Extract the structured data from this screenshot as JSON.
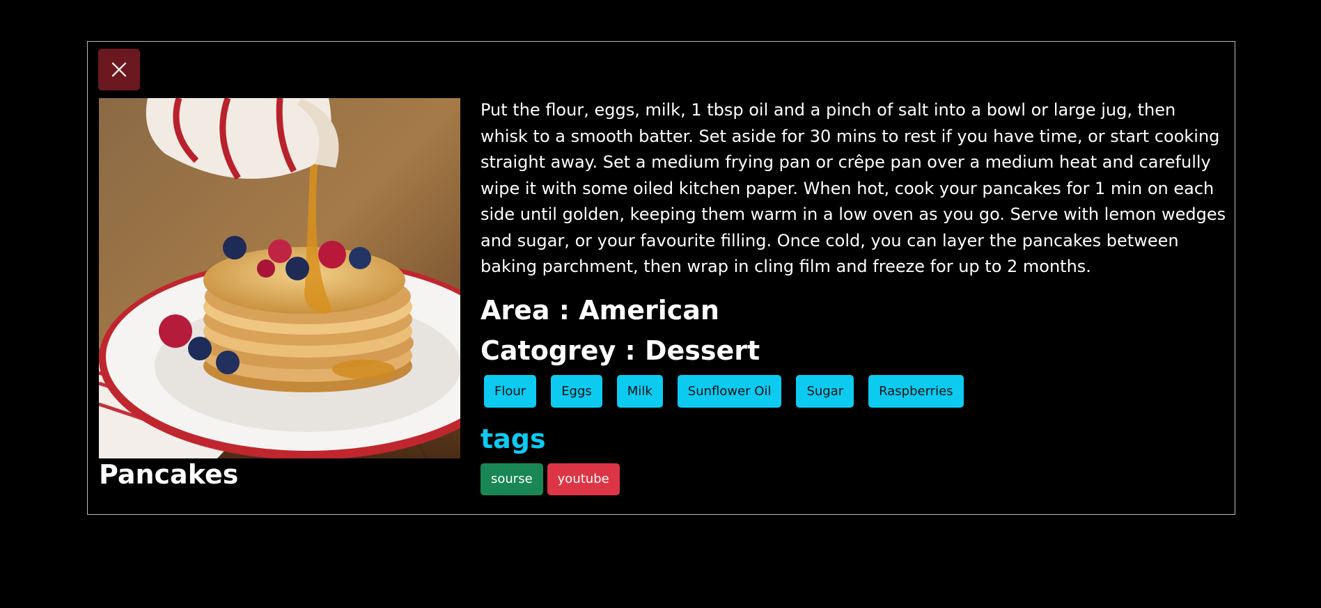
{
  "meal": {
    "name": "Pancakes",
    "image_alt": "Stack of pancakes with berries and syrup",
    "instructions": "Put the flour, eggs, milk, 1 tbsp oil and a pinch of salt into a bowl or large jug, then whisk to a smooth batter. Set aside for 30 mins to rest if you have time, or start cooking straight away. Set a medium frying pan or crêpe pan over a medium heat and carefully wipe it with some oiled kitchen paper. When hot, cook your pancakes for 1 min on each side until golden, keeping them warm in a low oven as you go. Serve with lemon wedges and sugar, or your favourite filling. Once cold, you can layer the pancakes between baking parchment, then wrap in cling film and freeze for up to 2 months.",
    "area_text": "Area : American",
    "category_text": "Catogrey : Dessert",
    "ingredients": [
      "Flour",
      "Eggs",
      "Milk",
      "Sunflower Oil",
      "Sugar",
      "Raspberries"
    ],
    "tags_title": "tags",
    "tags": {
      "source_label": "sourse",
      "youtube_label": "youtube"
    }
  },
  "colors": {
    "background": "#000000",
    "close_button": "#6b1820",
    "ingredient_badge": "#0dcaf0",
    "tag_source": "#198754",
    "tag_youtube": "#dc3545",
    "tags_title": "#0dcaf0"
  },
  "icons": {
    "close": "close-icon"
  }
}
